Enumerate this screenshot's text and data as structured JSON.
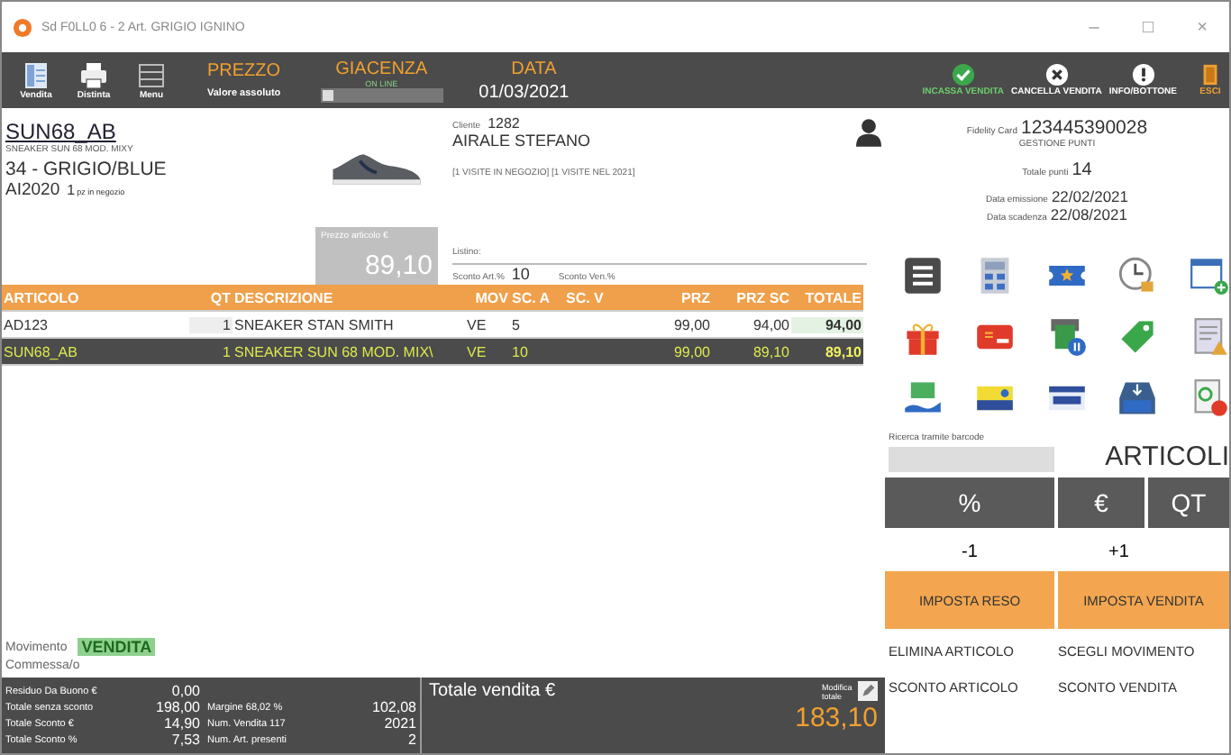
{
  "window": {
    "title": "Sd F0LL0 6 - 2 Art. GRIGIO IGNINO",
    "controls": [
      "–",
      "□",
      "×"
    ]
  },
  "toolbar": {
    "tools": [
      {
        "kind": "list",
        "label": "Vendita"
      },
      {
        "kind": "print",
        "label": "Distinta"
      },
      {
        "kind": "menu",
        "label": "Menu"
      }
    ],
    "prezzo": {
      "title": "PREZZO",
      "value": "Valore assoluto"
    },
    "giacenza": {
      "title": "GIACENZA",
      "subtitle": "ON LINE"
    },
    "data": {
      "title": "DATA",
      "value": "01/03/2021"
    },
    "actions": [
      {
        "kind": "check",
        "label": "INCASSA VENDITA"
      },
      {
        "kind": "cancel",
        "label": "CANCELLA VENDITA"
      },
      {
        "kind": "info",
        "label": "INFO/BOTTONE"
      },
      {
        "kind": "exit",
        "label": "ESCI"
      }
    ]
  },
  "article": {
    "code": "SUN68_AB",
    "description": "SNEAKER SUN 68 MOD. MIXY",
    "variant": "34 - GRIGIO/BLUE",
    "season": "AI2020",
    "stock": "1",
    "stock_label": "pz in negozio",
    "price_label": "Prezzo articolo €",
    "price": "89,10"
  },
  "customer": {
    "id_label": "Cliente",
    "id": "1282",
    "name": "AIRALE  STEFANO",
    "visits": "[1 VISITE IN NEGOZIO] [1 VISITE NEL 2021]",
    "listino_label": "Listino:",
    "discount_art_label": "Sconto Art.%",
    "discount_art": "10",
    "discount_sale_label": "Sconto Ven.%"
  },
  "fidelity": {
    "label": "Fidelity Card",
    "number": "123445390028",
    "manage": "GESTIONE PUNTI",
    "points_label": "Totale punti",
    "points": "14",
    "issued_label": "Data emissione",
    "issued": "22/02/2021",
    "expiry_label": "Data scadenza",
    "expiry": "22/08/2021"
  },
  "table": {
    "columns": [
      "ARTICOLO",
      "QT",
      "DESCRIZIONE",
      "MOV",
      "SC. A",
      "SC. V",
      "PRZ",
      "PRZ SC",
      "TOTALE"
    ],
    "rows": [
      {
        "selected": false,
        "cells": [
          "AD123",
          "1",
          "SNEAKER STAN SMITH",
          "VE",
          "5",
          "",
          "99,00",
          "94,00",
          "94,00"
        ]
      },
      {
        "selected": true,
        "cells": [
          "SUN68_AB",
          "1",
          "SNEAKER SUN 68 MOD. MIX\\",
          "VE",
          "10",
          "",
          "99,00",
          "89,10",
          "89,10"
        ]
      }
    ]
  },
  "barcode": {
    "label": "Ricerca tramite barcode"
  },
  "mode_title": "ARTICOLI",
  "mode_buttons": [
    "%",
    "€",
    "QT"
  ],
  "steps": [
    "-1",
    "+1"
  ],
  "set_buttons": [
    "IMPOSTA RESO",
    "IMPOSTA VENDITA"
  ],
  "movement": {
    "label": "Movimento",
    "value": "VENDITA",
    "clerk_label": "Commessa/o"
  },
  "summary": {
    "rows": [
      [
        "Residuo Da Buono €",
        "0,00",
        "",
        ""
      ],
      [
        "Totale senza sconto",
        "198,00",
        "Margine  68,02 %",
        "102,08"
      ],
      [
        "Totale Sconto €",
        "14,90",
        "Num. Vendita 117",
        "2021"
      ],
      [
        "Totale Sconto %",
        "7,53",
        "Num. Art. presenti",
        "2"
      ]
    ],
    "total_label": "Totale vendita €",
    "edit_label": "Modifica totale",
    "total": "183,10"
  },
  "bottom_buttons": [
    "ELIMINA ARTICOLO",
    "SCEGLI MOVIMENTO",
    "SCONTO ARTICOLO",
    "SCONTO VENDITA"
  ]
}
